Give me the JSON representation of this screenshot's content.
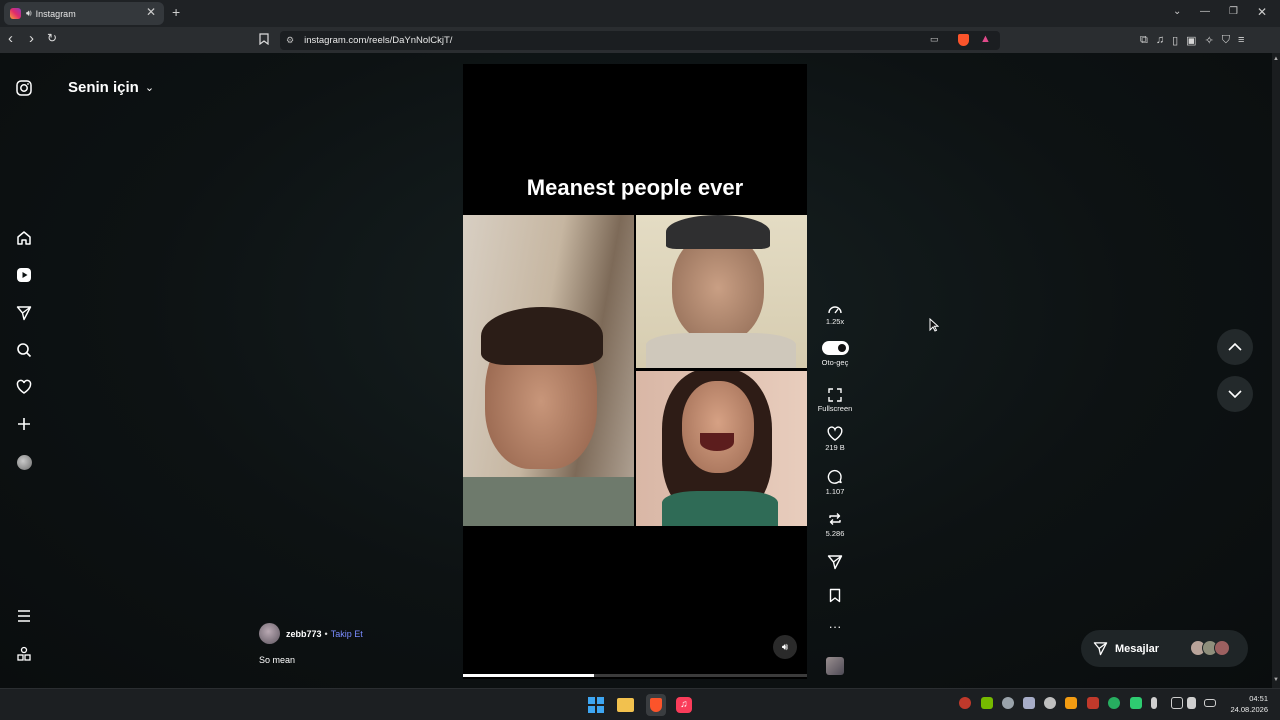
{
  "browser": {
    "tab_title": "Instagram",
    "new_tab": "+",
    "url": "instagram.com/reels/DaYnNolCkjT/"
  },
  "feed": {
    "title": "Senin için"
  },
  "reel": {
    "caption_overlay": "Meanest people ever",
    "author": "zebb773",
    "separator": "•",
    "follow_label": "Takip Et",
    "description": "So mean",
    "progress": 0.38
  },
  "actions": {
    "speed": "1.25x",
    "autoplay_label": "Oto-geç",
    "fullscreen_label": "Fullscreen",
    "likes": "219 B",
    "comments": "1.107",
    "reposts": "5.286"
  },
  "messages": {
    "label": "Mesajlar"
  },
  "taskbar": {
    "time": "04:51",
    "date": "24.08.2026"
  },
  "colors": {
    "accent_link": "#7a8cff",
    "background": "#0c0f10",
    "brave": "#fb542b"
  }
}
